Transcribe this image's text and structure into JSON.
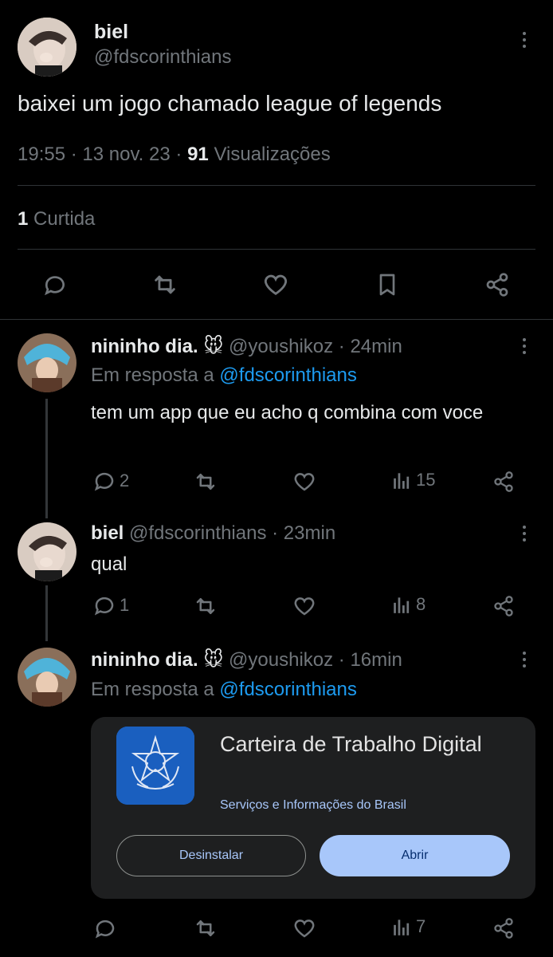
{
  "main_tweet": {
    "display_name": "biel",
    "handle": "@fdscorinthians",
    "text": "baixei um jogo chamado league of legends",
    "time": "19:55",
    "separator": "·",
    "date": "13 nov. 23",
    "views_count": "91",
    "views_label": "Visualizações",
    "likes_count": "1",
    "likes_label": "Curtida"
  },
  "replies": [
    {
      "display_name": "nininho dia.",
      "name_emoji": "🐭",
      "handle": "@youshikoz",
      "time": "· 24min",
      "reply_prefix": "Em resposta a",
      "reply_to": "@fdscorinthians",
      "text": "tem um app que eu acho q combina com voce",
      "replies": "2",
      "views": "15"
    },
    {
      "display_name": "biel",
      "handle": "@fdscorinthians",
      "time": "· 23min",
      "text": "qual",
      "replies": "1",
      "views": "8"
    },
    {
      "display_name": "nininho dia.",
      "name_emoji": "🐭",
      "handle": "@youshikoz",
      "time": "· 16min",
      "reply_prefix": "Em resposta a",
      "reply_to": "@fdscorinthians",
      "views": "7"
    }
  ],
  "app_card": {
    "title": "Carteira de Trabalho Digital",
    "developer": "Serviços e Informações do Brasil",
    "uninstall_label": "Desinstalar",
    "open_label": "Abrir",
    "icon_color": "#1a5fbf"
  },
  "colors": {
    "background": "#000000",
    "text": "#e7e9ea",
    "muted": "#71767b",
    "link": "#1d9bf0",
    "divider": "#2f3336",
    "card": "#1e1f20",
    "open_button": "#a8c7fa"
  }
}
